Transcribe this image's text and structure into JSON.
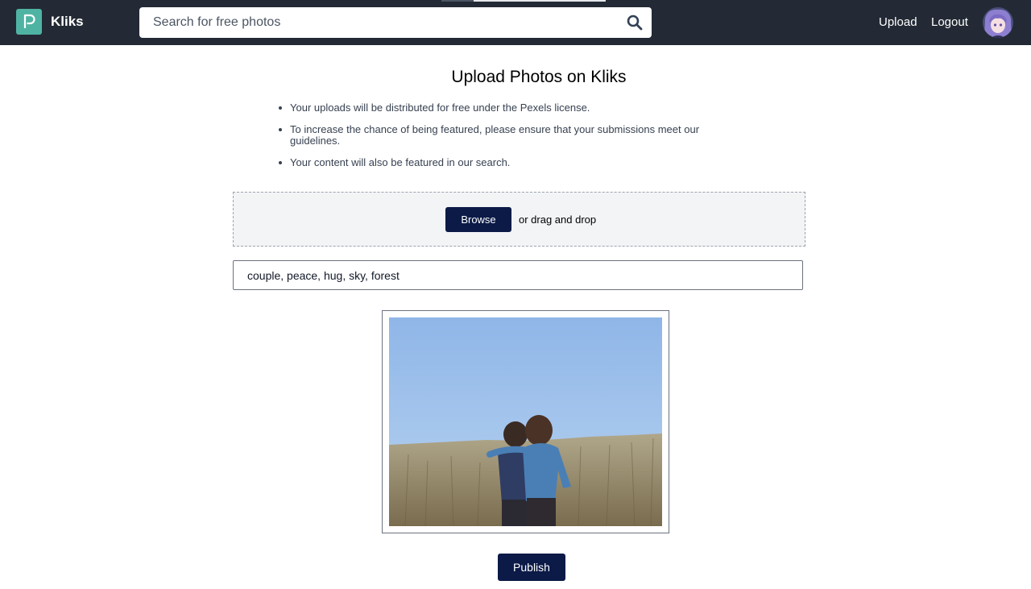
{
  "navbar": {
    "brand": "Kliks",
    "search_placeholder": "Search for free photos",
    "links": {
      "upload": "Upload",
      "logout": "Logout"
    }
  },
  "main": {
    "title": "Upload Photos on Kliks",
    "rules": [
      "Your uploads will be distributed for free under the Pexels license.",
      "To increase the chance of being featured, please ensure that your submissions meet our guidelines.",
      "Your content will also be featured in our search."
    ],
    "dropzone": {
      "browse_label": "Browse",
      "drag_text": "or drag and drop"
    },
    "tags_value": "couple, peace, hug, sky, forest",
    "publish_label": "Publish"
  },
  "colors": {
    "navbar_bg": "#232a35",
    "brand_logo": "#4fb3a3",
    "button_bg": "#0b1a47"
  },
  "icons": {
    "logo": "kliks-logo-icon",
    "search": "search-icon",
    "avatar": "user-avatar"
  }
}
